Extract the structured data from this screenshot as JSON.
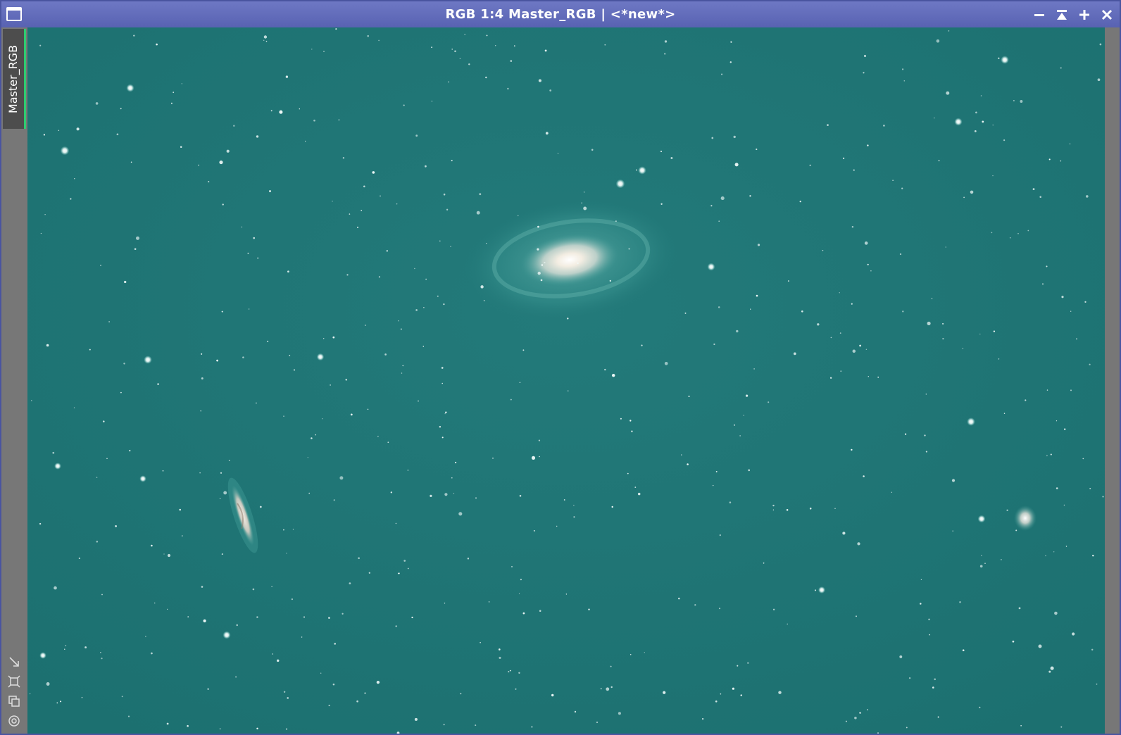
{
  "window": {
    "title": "RGB 1:4 Master_RGB | <*new*>",
    "controls": {
      "minimize": "minimize-icon",
      "shade": "shade-icon",
      "maximize": "plus-icon",
      "close": "close-icon"
    }
  },
  "sidebar": {
    "tab_label": "Master_RGB",
    "tools": [
      "resize-icon",
      "fit-icon",
      "clone-icon",
      "target-icon"
    ]
  },
  "image": {
    "background_color": "#1f7676",
    "accent_color": "#2ecc71",
    "titlebar_color": "#5f69b9"
  }
}
